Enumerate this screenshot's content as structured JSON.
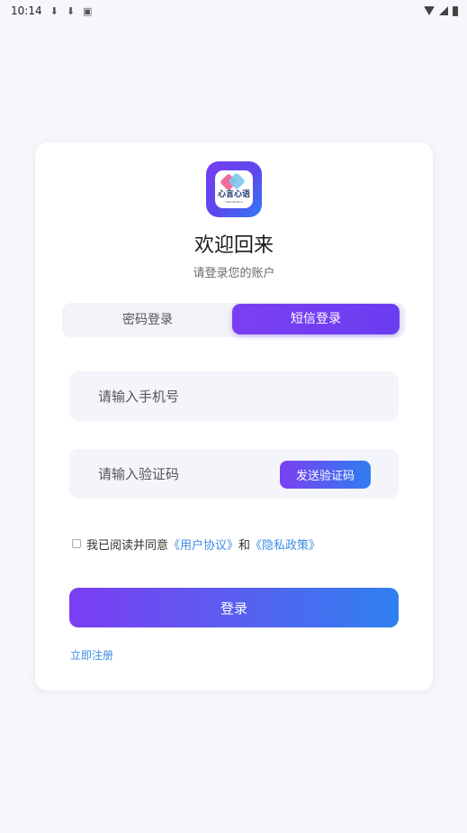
{
  "status_bar": {
    "time": "10:14",
    "icons": [
      "download-icon",
      "download-icon",
      "app-icon"
    ],
    "right_icons": [
      "wifi-icon",
      "signal-icon",
      "battery-icon"
    ]
  },
  "logo": {
    "text": "心言心语",
    "subtext": "XINYANXINYU"
  },
  "title": "欢迎回来",
  "subtitle": "请登录您的账户",
  "tabs": [
    {
      "label": "密码登录",
      "active": false
    },
    {
      "label": "短信登录",
      "active": true
    }
  ],
  "phone_field": {
    "placeholder": "请输入手机号",
    "value": ""
  },
  "code_field": {
    "placeholder": "请输入验证码",
    "value": ""
  },
  "send_code_label": "发送验证码",
  "agreement": {
    "prefix": "我已阅读并同意",
    "user_agreement": "《用户协议》",
    "and": "和",
    "privacy_policy": "《隐私政策》",
    "checked": false
  },
  "login_label": "登录",
  "register_label": "立即注册",
  "colors": {
    "accent_purple": "#7b3ff2",
    "accent_blue": "#2f80f0",
    "link": "#3c8ce6",
    "background": "#f6f6fb"
  }
}
